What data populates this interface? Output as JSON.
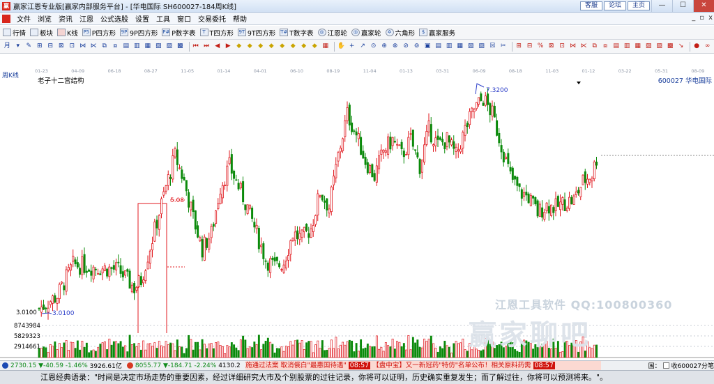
{
  "titlebar": {
    "title": "赢家江恩专业版[赢家内部服务平台] - [华电国际  SH600027-184周K线]",
    "links": [
      "客服",
      "论坛",
      "主页"
    ],
    "window_buttons": [
      "—",
      "☐",
      "✕"
    ]
  },
  "menubar": {
    "items": [
      "文件",
      "浏览",
      "资讯",
      "江恩",
      "公式选股",
      "设置",
      "工具",
      "窗口",
      "交易委托",
      "帮助"
    ],
    "mdi_buttons": [
      "_",
      "▫",
      "x"
    ]
  },
  "toolbar1": {
    "items": [
      {
        "label": "行情",
        "icon": "grid-icon"
      },
      {
        "label": "板块",
        "icon": "blocks-icon"
      },
      {
        "label": "K线",
        "icon": "kline-icon"
      },
      {
        "label": "P四方形",
        "icon": "p-square-icon",
        "badge": "P5"
      },
      {
        "label": "9P四方形",
        "icon": "9p-square-icon",
        "badge": "9P"
      },
      {
        "label": "P数字表",
        "icon": "p-table-icon",
        "badge": "P#"
      },
      {
        "label": "T四方形",
        "icon": "t-square-icon",
        "badge": "T"
      },
      {
        "label": "9T四方形",
        "icon": "9t-square-icon",
        "badge": "9T"
      },
      {
        "label": "T数字表",
        "icon": "t-table-icon",
        "badge": "T#"
      },
      {
        "label": "江恩轮",
        "icon": "gann-wheel-icon",
        "badge": "◎"
      },
      {
        "label": "赢家轮",
        "icon": "winner-wheel-icon",
        "badge": "◎"
      },
      {
        "label": "六角形",
        "icon": "hexagon-icon",
        "badge": "✡"
      },
      {
        "label": "赢家服务",
        "icon": "dollar-icon",
        "badge": "$"
      }
    ]
  },
  "toolbar2": {
    "groups": [
      [
        "月",
        "▾",
        "✎",
        "⊞",
        "⊟",
        "⊠",
        "⊡",
        "⋈",
        "⋉",
        "⧉",
        "⧈",
        "▤",
        "▥",
        "▦",
        "▧",
        "▨",
        "▩"
      ],
      [
        "⏮",
        "⏭",
        "◀",
        "▶",
        "◆",
        "◆",
        "◆",
        "◆",
        "◆",
        "◆",
        "◆",
        "◆",
        "▦"
      ],
      [
        "✋",
        "+",
        "↗",
        "⊙",
        "⊕",
        "⊗",
        "⊘",
        "⊚",
        "▣",
        "▤",
        "▥",
        "▦",
        "▧",
        "▨",
        "☒",
        "✂"
      ],
      [
        "⊞",
        "⊟",
        "%",
        "⊠",
        "⊡",
        "⋈",
        "⋉",
        "⧉",
        "⧈",
        "▤",
        "▥",
        "▦",
        "▧",
        "▨",
        "▩",
        "↘"
      ],
      [
        "●",
        "∞"
      ]
    ]
  },
  "chart": {
    "period": "周K线",
    "indicator": "老子十二宫结构",
    "stock": "600027  华电国际",
    "dates": [
      "01-23",
      "04-09",
      "06-18",
      "08-27",
      "11-05",
      "01-14",
      "04-01",
      "06-10",
      "08-19",
      "11-04",
      "01-13",
      "03-31",
      "06-09",
      "08-18",
      "11-03",
      "01-12",
      "03-22",
      "05-31",
      "08-09"
    ],
    "labels": {
      "high": "7.3200",
      "low": "3.0100",
      "low_axis": "3.0100",
      "mid": "5.08"
    },
    "volume_axis": [
      "8743984",
      "5829323",
      "2914661"
    ],
    "watermark_main": "江恩工具软件  QQ:100800360",
    "watermark_brand": "赢家聊吧",
    "colors": {
      "up": "#e0191f",
      "down": "#0b8a0b",
      "ma": "#2c3ec9",
      "box": "#e0191f",
      "grid": "#c8ccd4"
    }
  },
  "statusbar": {
    "index1": "2730.15",
    "change1": "▼-40.59",
    "pct1": "-1.46%",
    "amount1": "3926.61亿",
    "index2": "8055.77",
    "change2": "▼-184.71",
    "pct2": "-2.24%",
    "amount2": "4130.2",
    "ticker": "施通过法案 取消俄白\"最惠国待遇\"",
    "ticker_time1": "08:57",
    "ticker2": "【盘中宝】又一新冠药\"特仿\"名单公布！相关原料药需",
    "ticker_time2": "08:57",
    "right_text": "收600027分笔",
    "right_prefix": "国："
  },
  "quote_bar": {
    "text": "江恩经典语录：\"时间是决定市场走势的重要因素，经过详细研究大市及个别股票的过往记录，你将可以证明，历史确实重复发生；而了解过往，你将可以预测将来。\"。"
  }
}
